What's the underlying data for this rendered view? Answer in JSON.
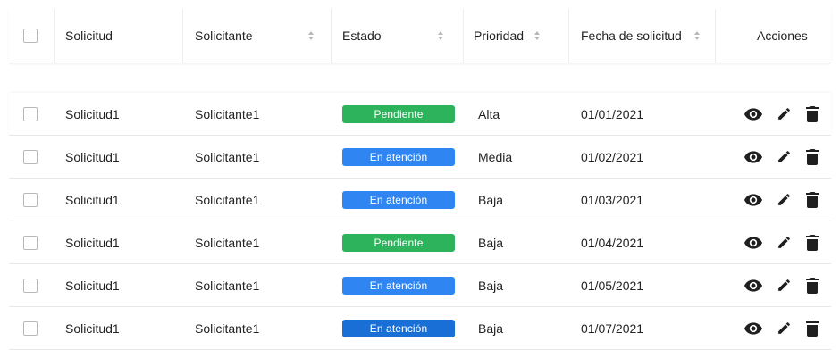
{
  "colors": {
    "pendiente": "#2db35c",
    "atencion": "#2f86f2",
    "atencion_dark": "#1a6fd6",
    "icon": "#1f1f1f"
  },
  "header": {
    "solicitud": "Solicitud",
    "solicitante": "Solicitante",
    "estado": "Estado",
    "prioridad": "Prioridad",
    "fecha": "Fecha de solicitud",
    "acciones": "Acciones"
  },
  "rows": [
    {
      "solicitud": "Solicitud1",
      "solicitante": "Solicitante1",
      "estado": "Pendiente",
      "estado_color": "#2db35c",
      "prioridad": "Alta",
      "fecha": "01/01/2021"
    },
    {
      "solicitud": "Solicitud1",
      "solicitante": "Solicitante1",
      "estado": "En atención",
      "estado_color": "#2f86f2",
      "prioridad": "Media",
      "fecha": "01/02/2021"
    },
    {
      "solicitud": "Solicitud1",
      "solicitante": "Solicitante1",
      "estado": "En atención",
      "estado_color": "#2f86f2",
      "prioridad": "Baja",
      "fecha": "01/03/2021"
    },
    {
      "solicitud": "Solicitud1",
      "solicitante": "Solicitante1",
      "estado": "Pendiente",
      "estado_color": "#2db35c",
      "prioridad": "Baja",
      "fecha": "01/04/2021"
    },
    {
      "solicitud": "Solicitud1",
      "solicitante": "Solicitante1",
      "estado": "En atención",
      "estado_color": "#2f86f2",
      "prioridad": "Baja",
      "fecha": "01/05/2021"
    },
    {
      "solicitud": "Solicitud1",
      "solicitante": "Solicitante1",
      "estado": "En atención",
      "estado_color": "#1a6fd6",
      "prioridad": "Baja",
      "fecha": "01/07/2021"
    }
  ],
  "actions": [
    "eye-icon",
    "pencil-icon",
    "trash-icon"
  ]
}
